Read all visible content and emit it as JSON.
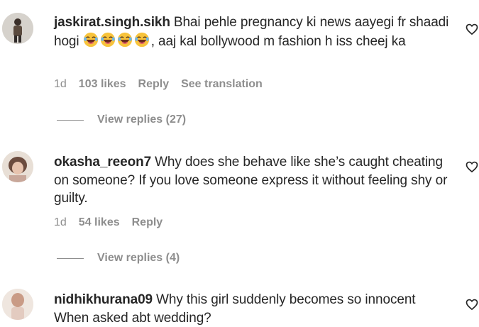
{
  "comments": [
    {
      "username": "jaskirat.singh.sikh",
      "text_before_emoji": "Bhai pehle pregnancy ki news aayegi fr shaadi hogi ",
      "emoji_count": 4,
      "emoji_icon": "rolling-on-floor-laughing-emoji",
      "text_after_emoji": ", aaj kal bollywood m fashion h iss cheej ka",
      "time": "1d",
      "likes": "103 likes",
      "reply_label": "Reply",
      "translation_label": "See translation",
      "view_replies": "View replies (27)"
    },
    {
      "username": "okasha_reeon7",
      "text": "Why does she behave like she’s caught cheating on someone? If you love someone express it without feeling shy or guilty.",
      "time": "1d",
      "likes": "54 likes",
      "reply_label": "Reply",
      "view_replies": "View replies (4)"
    },
    {
      "username": "nidhikhurana09",
      "text": "Why this girl suddenly becomes so innocent When asked abt wedding?"
    }
  ],
  "icons": {
    "like": "heart-outline-icon"
  },
  "colors": {
    "text": "#262626",
    "secondary": "#8e8e8e",
    "background": "#ffffff"
  }
}
